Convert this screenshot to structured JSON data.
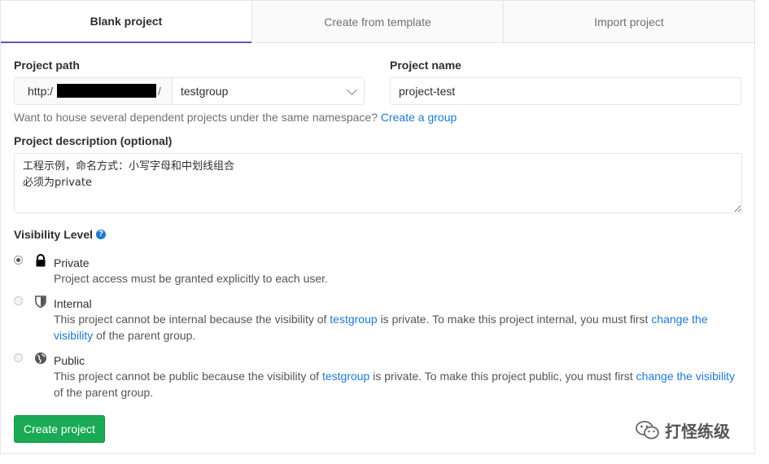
{
  "tabs": [
    {
      "label": "Blank project",
      "active": true
    },
    {
      "label": "Create from template",
      "active": false
    },
    {
      "label": "Import project",
      "active": false
    }
  ],
  "form": {
    "project_path_label": "Project path",
    "path_prefix": "http:/",
    "path_suffix": "/",
    "namespace_value": "testgroup",
    "project_name_label": "Project name",
    "project_name_value": "project-test",
    "namespace_hint": "Want to house several dependent projects under the same namespace?",
    "create_group_link": "Create a group",
    "description_label": "Project description (optional)",
    "description_value": "工程示例，命名方式：小写字母和中划线组合\n必须为private",
    "visibility_label": "Visibility Level",
    "help_icon": "?"
  },
  "visibility": {
    "private": {
      "title": "Private",
      "desc": "Project access must be granted explicitly to each user.",
      "checked": true,
      "icon": "lock-icon"
    },
    "internal": {
      "title": "Internal",
      "desc_pre": "This project cannot be internal because the visibility of",
      "group": "testgroup",
      "desc_mid": "is private. To make this project internal, you must first",
      "link": "change the visibility",
      "desc_post": "of the parent group.",
      "checked": false,
      "icon": "shield-icon"
    },
    "public": {
      "title": "Public",
      "desc_pre": "This project cannot be public because the visibility of",
      "group": "testgroup",
      "desc_mid": "is private. To make this project public, you must first",
      "link": "change the visibility",
      "desc_post": "of the parent group.",
      "checked": false,
      "icon": "globe-icon"
    }
  },
  "create_button": "Create project",
  "watermark": "打怪练级",
  "colors": {
    "accent_tab": "#6b4fbb",
    "link": "#1f78d1",
    "create_button": "#1aaa55"
  }
}
